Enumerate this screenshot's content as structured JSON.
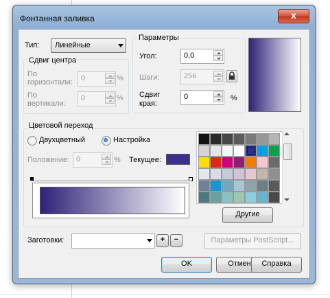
{
  "window": {
    "title": "Фонтанная заливка",
    "close_glyph": "x"
  },
  "type_row": {
    "label": "Тип:",
    "value": "Линейные"
  },
  "center_offset": {
    "title": "Сдвиг центра",
    "horizontal_label_1": "По",
    "horizontal_label_2": "горизонтали:",
    "horizontal_value": "0",
    "vertical_label_1": "По",
    "vertical_label_2": "вертикали:",
    "vertical_value": "0",
    "unit": "%"
  },
  "params": {
    "title": "Параметры",
    "angle_label": "Угол:",
    "angle_value": "0,0",
    "steps_label": "Шаги:",
    "steps_value": "256",
    "edge_label_1": "Сдвиг",
    "edge_label_2": "края:",
    "edge_value": "0",
    "edge_unit": "%"
  },
  "color_blend": {
    "title": "Цветовой переход",
    "two_color_label": "Двухцветный",
    "custom_label": "Настройка",
    "selected_mode": "custom",
    "position_label": "Положение:",
    "position_value": "0",
    "position_unit": "%",
    "current_label": "Текущее:",
    "current_color": "#3b2f8f",
    "gradient_start": "#2e2378",
    "gradient_end": "#ffffff",
    "other_button": "Другие"
  },
  "palette": {
    "rows": [
      [
        "#111111",
        "#2b2b2b",
        "#464646",
        "#5c5c5c",
        "#7a7a7a",
        "#979797",
        "#b5b5b5"
      ],
      [
        "#d3d3d3",
        "#e6e6e6",
        "#f6f6f6",
        "#ffffff",
        "#2b2f8f",
        "#00a0e3",
        "#0aa24a"
      ],
      [
        "#ffde00",
        "#e3261c",
        "#d0007c",
        "#8e1b74",
        "#f07c00",
        "#f6c7ce",
        "#6a6a6a"
      ],
      [
        "#e3e7ef",
        "#d6dce8",
        "#c4ccd9",
        "#d3c2d8",
        "#e8c6d0",
        "#c4b6a8",
        "#8f8f8f"
      ],
      [
        "#6f7f9a",
        "#1d93cf",
        "#6fa8c0",
        "#a8c6d6",
        "#8ea4ac",
        "#6c7f86",
        "#5a5a5a"
      ],
      [
        "#4f7a7c",
        "#6aa1a0",
        "#8dc1c0",
        "#9ac9ad",
        "#8fcde0",
        "#6ab3cc",
        "#4a4a4a"
      ]
    ],
    "selected": [
      1,
      4
    ]
  },
  "presets": {
    "label": "Заготовки:",
    "value": "",
    "add_glyph": "+",
    "remove_glyph": "−",
    "postscript_button": "Параметры PostScript..."
  },
  "buttons": {
    "ok": "OK",
    "cancel": "Отмена",
    "help": "Справка"
  },
  "colors": {
    "preview_start": "#2e2378",
    "preview_end": "#ffffff"
  }
}
